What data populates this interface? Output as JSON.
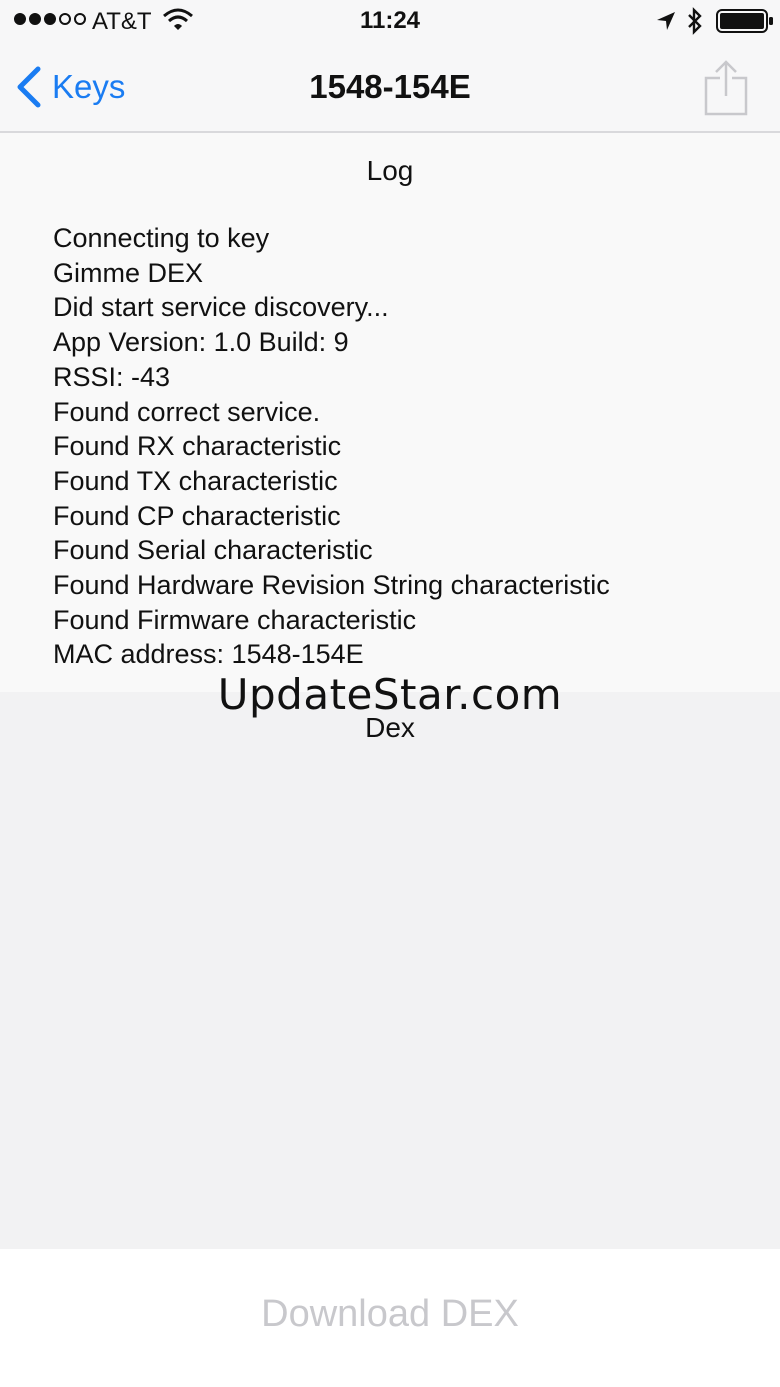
{
  "status_bar": {
    "carrier": "AT&T",
    "time": "11:24",
    "signal_bars_filled": 3,
    "signal_bars_total": 5,
    "icons": [
      "wifi-icon",
      "location-icon",
      "bluetooth-icon",
      "battery-icon"
    ]
  },
  "nav": {
    "back_label": "Keys",
    "title": "1548-154E",
    "share_icon": "share-icon",
    "accent_color": "#1a7cf2"
  },
  "log": {
    "title": "Log",
    "lines": [
      "Connecting to key",
      "Gimme DEX",
      "Did start service discovery...",
      "App Version: 1.0 Build: 9",
      "RSSI: -43",
      "Found correct service.",
      "Found RX characteristic",
      "Found TX characteristic",
      "Found CP characteristic",
      "Found Serial characteristic",
      "Found Hardware Revision String characteristic",
      "Found Firmware characteristic",
      "MAC address: 1548-154E"
    ]
  },
  "dex": {
    "title": "Dex"
  },
  "watermark": "UpdateStar.com",
  "actions": {
    "download_label": "Download DEX",
    "download_color": "#c8c8cc"
  }
}
